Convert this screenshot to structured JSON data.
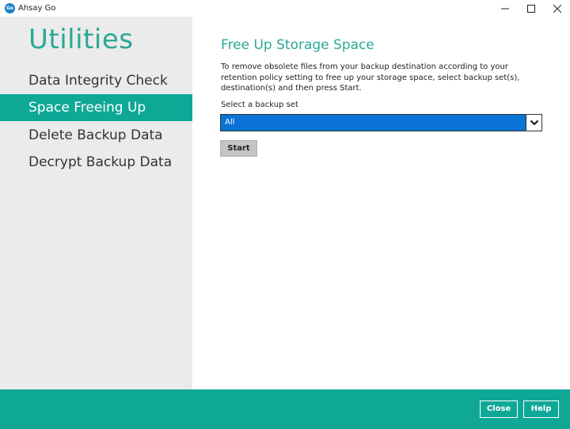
{
  "window": {
    "app_icon_text": "Go",
    "title": "Ahsay Go"
  },
  "sidebar": {
    "title": "Utilities",
    "items": [
      {
        "label": "Data Integrity Check",
        "active": false
      },
      {
        "label": "Space Freeing Up",
        "active": true
      },
      {
        "label": "Delete Backup Data",
        "active": false
      },
      {
        "label": "Decrypt Backup Data",
        "active": false
      }
    ]
  },
  "main": {
    "title": "Free Up Storage Space",
    "description": "To remove obsolete files from your backup destination according to your retention policy setting to free up your storage space, select backup set(s), destination(s) and then press Start.",
    "select_label": "Select a backup set",
    "select_value": "All",
    "start_label": "Start"
  },
  "footer": {
    "close_label": "Close",
    "help_label": "Help"
  },
  "colors": {
    "accent": "#0fa897",
    "title_teal": "#2aa896",
    "select_highlight": "#0a73d7",
    "sidebar_bg": "#ebebeb"
  },
  "icons": {
    "app": "ahsay-go-icon",
    "minimize": "minimize-icon",
    "maximize": "maximize-icon",
    "close": "close-icon",
    "dropdown": "chevron-down-icon"
  }
}
